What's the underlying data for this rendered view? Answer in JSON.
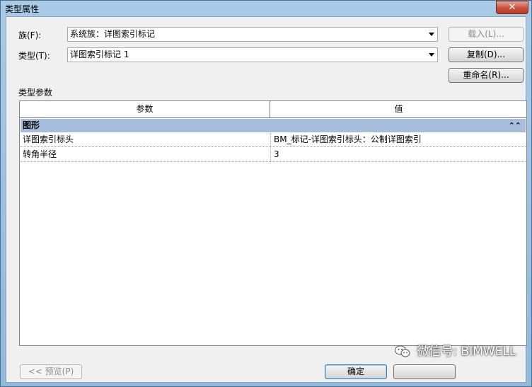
{
  "window": {
    "title": "类型属性",
    "close_label": "✕"
  },
  "family": {
    "label": "族(F):",
    "value": "系统族：详图索引标记"
  },
  "type": {
    "label": "类型(T):",
    "value": "详图索引标记 1"
  },
  "buttons": {
    "load": "载入(L)...",
    "duplicate": "复制(D)...",
    "rename": "重命名(R)...",
    "preview": "<< 预览(P)",
    "ok": "确定"
  },
  "type_params": {
    "section_label": "类型参数",
    "headers": [
      "参数",
      "值"
    ],
    "groups": [
      {
        "name": "图形",
        "collapse_icon": "double-chevron-up-icon",
        "rows": [
          {
            "param": "详图索引标头",
            "value": "BM_标记-详图索引标头：公制详图索引"
          },
          {
            "param": "转角半径",
            "value": "3"
          }
        ]
      }
    ]
  },
  "watermark": {
    "text": "微信号: BIMWELL",
    "icon": "wechat-icon"
  },
  "colors": {
    "group_header_bg": "#a6bedb",
    "close_button": "#c7513c",
    "dialog_bg": "#f0f0f0"
  }
}
